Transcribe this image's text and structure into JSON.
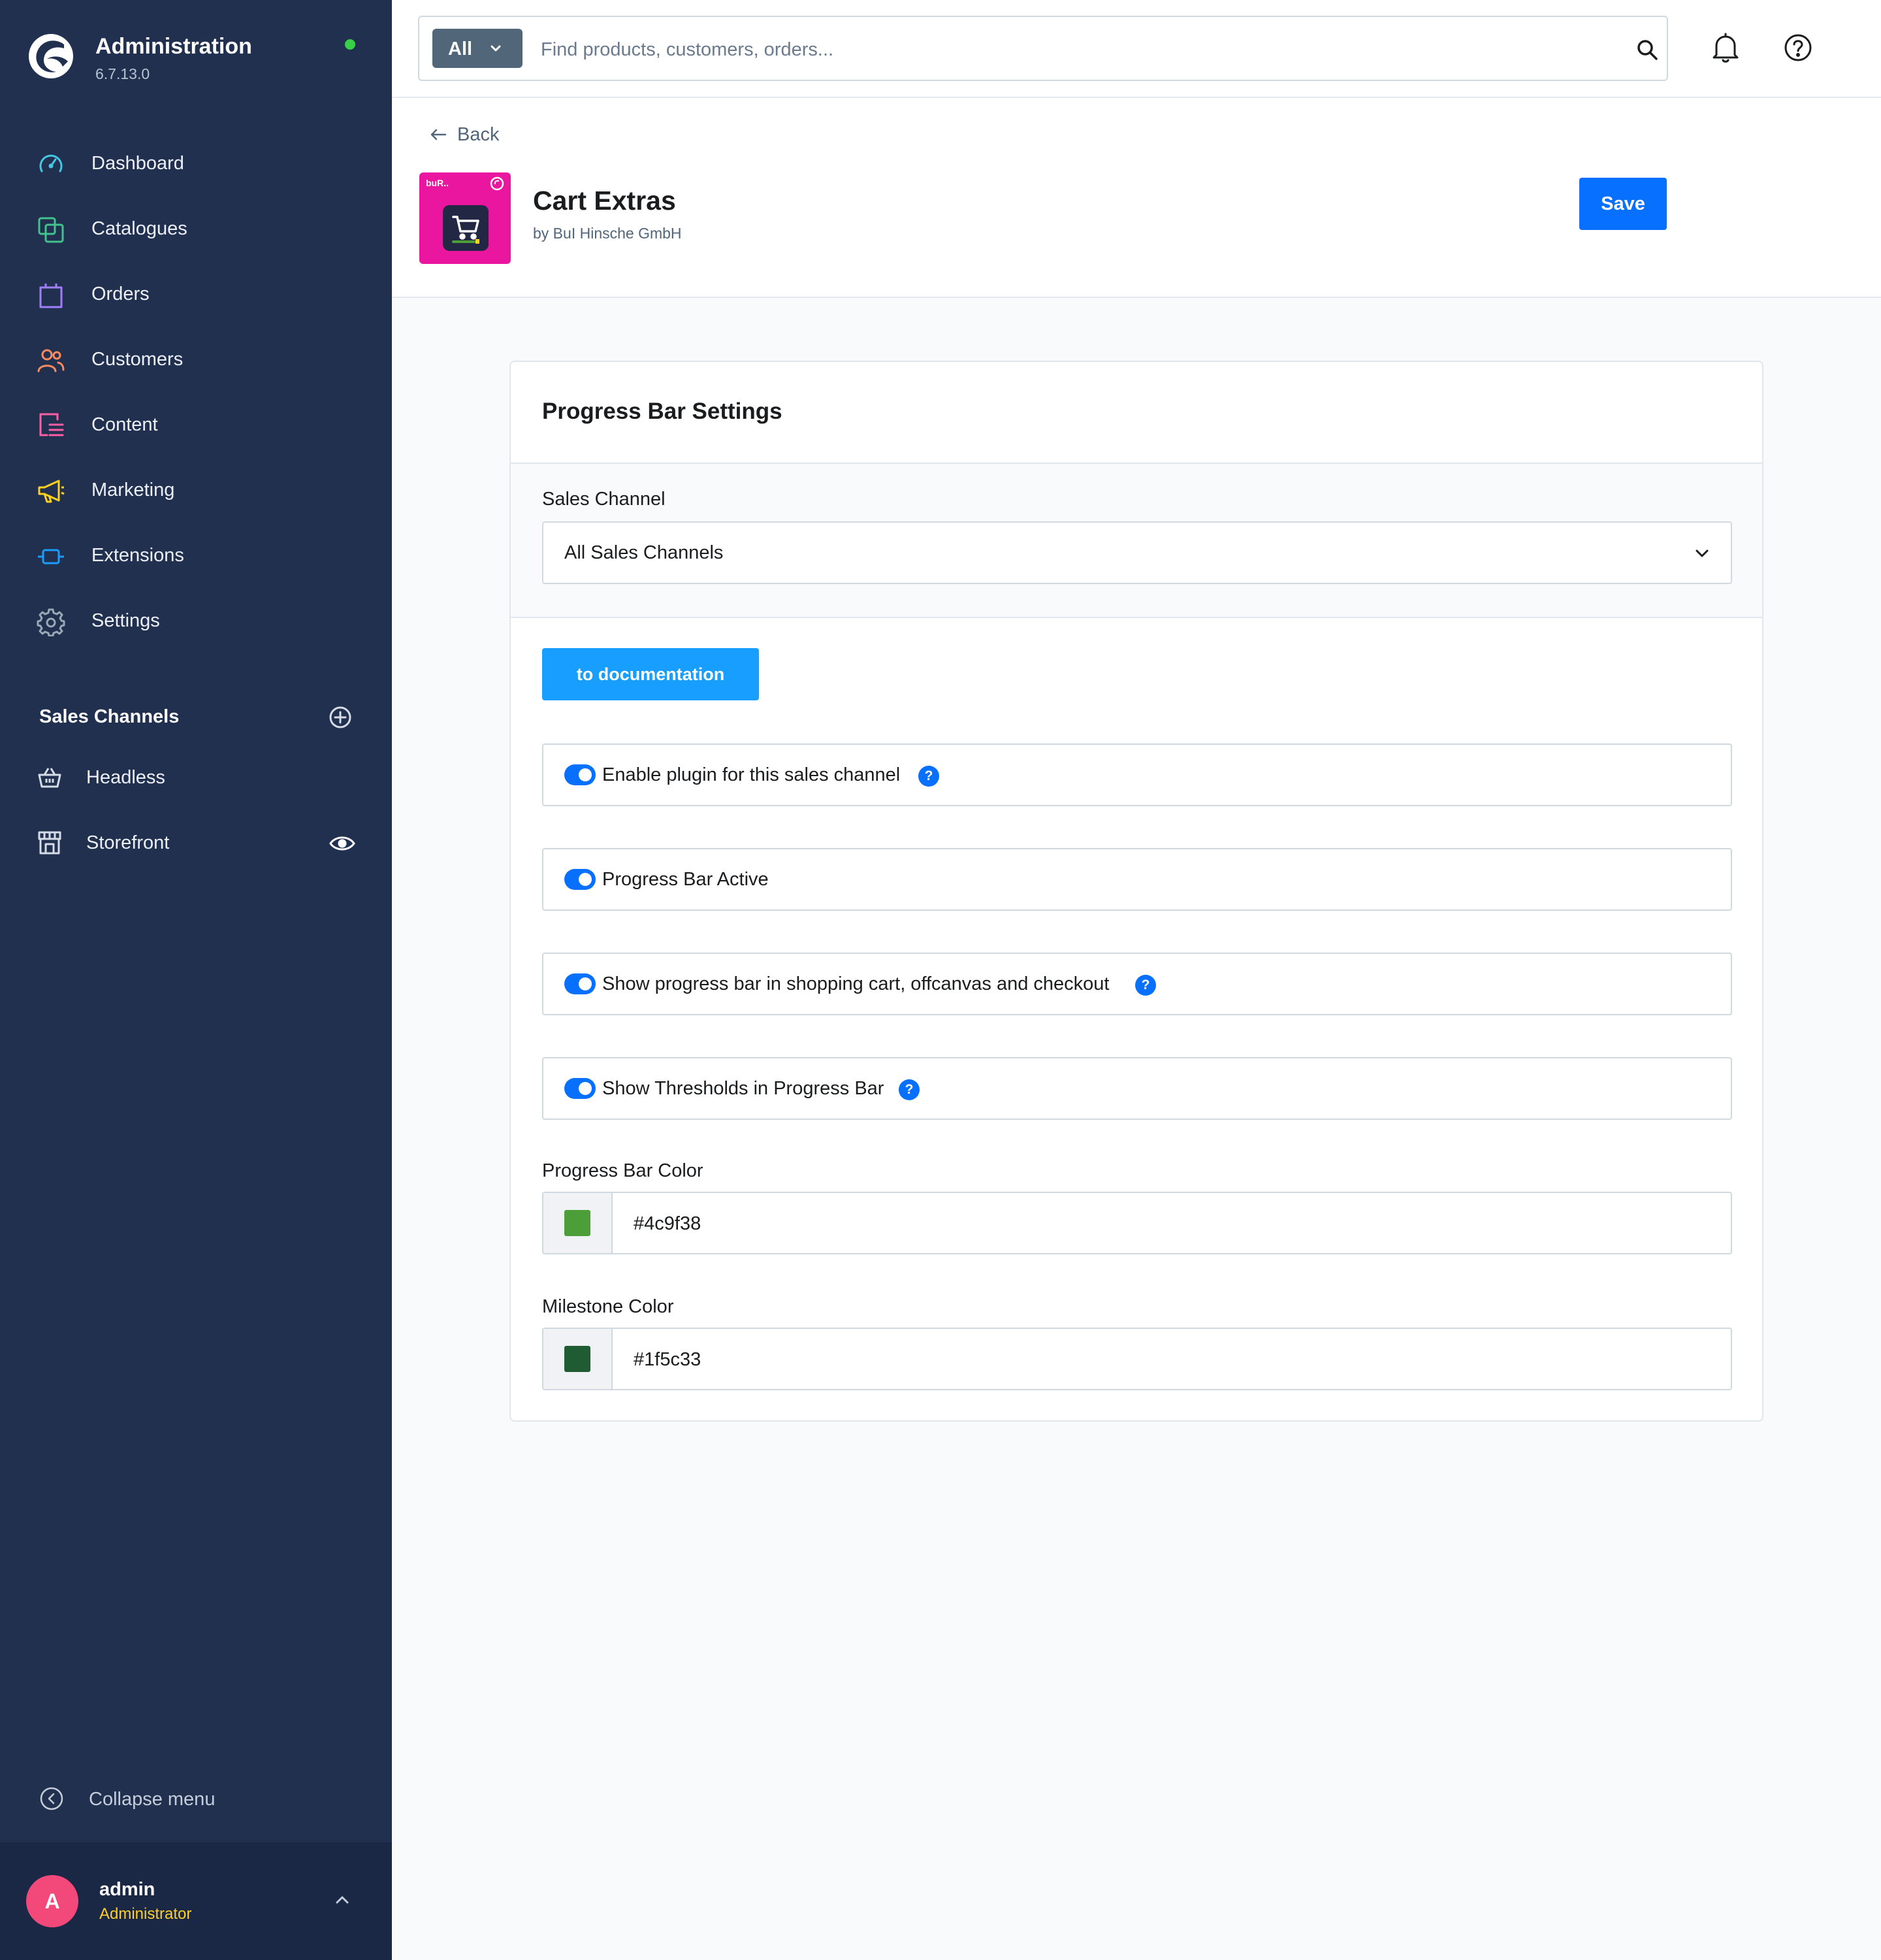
{
  "brand": {
    "title": "Administration",
    "version": "6.7.13.0"
  },
  "nav": [
    {
      "label": "Dashboard",
      "icon": "dashboard-icon",
      "color": "#46c6e5"
    },
    {
      "label": "Catalogues",
      "icon": "catalogues-icon",
      "color": "#42c38e"
    },
    {
      "label": "Orders",
      "icon": "orders-icon",
      "color": "#a17ffc"
    },
    {
      "label": "Customers",
      "icon": "customers-icon",
      "color": "#fc8b5e"
    },
    {
      "label": "Content",
      "icon": "content-icon",
      "color": "#ff5ea4"
    },
    {
      "label": "Marketing",
      "icon": "marketing-icon",
      "color": "#ffd01f"
    },
    {
      "label": "Extensions",
      "icon": "extensions-icon",
      "color": "#189eff"
    },
    {
      "label": "Settings",
      "icon": "settings-icon",
      "color": "#9aa8b5"
    }
  ],
  "sales_channels": {
    "title": "Sales Channels",
    "items": [
      {
        "label": "Headless",
        "icon": "basket-icon"
      },
      {
        "label": "Storefront",
        "icon": "storefront-icon"
      }
    ]
  },
  "collapse_label": "Collapse menu",
  "user": {
    "initial": "A",
    "name": "admin",
    "role": "Administrator"
  },
  "search": {
    "type_label": "All",
    "placeholder": "Find products, customers, orders..."
  },
  "header": {
    "back_label": "Back",
    "plugin_title": "Cart Extras",
    "plugin_vendor": "by BuI Hinsche GmbH",
    "plugin_icon_text": "buR..",
    "save_label": "Save"
  },
  "card": {
    "title": "Progress Bar Settings",
    "sales_channel_label": "Sales Channel",
    "sales_channel_value": "All Sales Channels",
    "doc_button": "to documentation",
    "switches": [
      {
        "label": "Enable plugin for this sales channel",
        "on": true,
        "help": true
      },
      {
        "label": "Progress Bar Active",
        "on": true,
        "help": false
      },
      {
        "label": "Show progress bar in shopping cart, offcanvas and checkout",
        "on": true,
        "help": true
      },
      {
        "label": "Show Thresholds in Progress Bar",
        "on": true,
        "help": true
      }
    ],
    "progress_color_label": "Progress Bar Color",
    "progress_color_value": "#4c9f38",
    "milestone_color_label": "Milestone Color",
    "milestone_color_value": "#1f5c33"
  },
  "colors": {
    "sidebar": "#223050",
    "primary": "#0870ff",
    "doc_button": "#189eff",
    "plugin_icon_bg": "#ea16a0",
    "status_online": "#37d046",
    "user_role": "#ffcf24",
    "avatar": "#f2487a"
  }
}
